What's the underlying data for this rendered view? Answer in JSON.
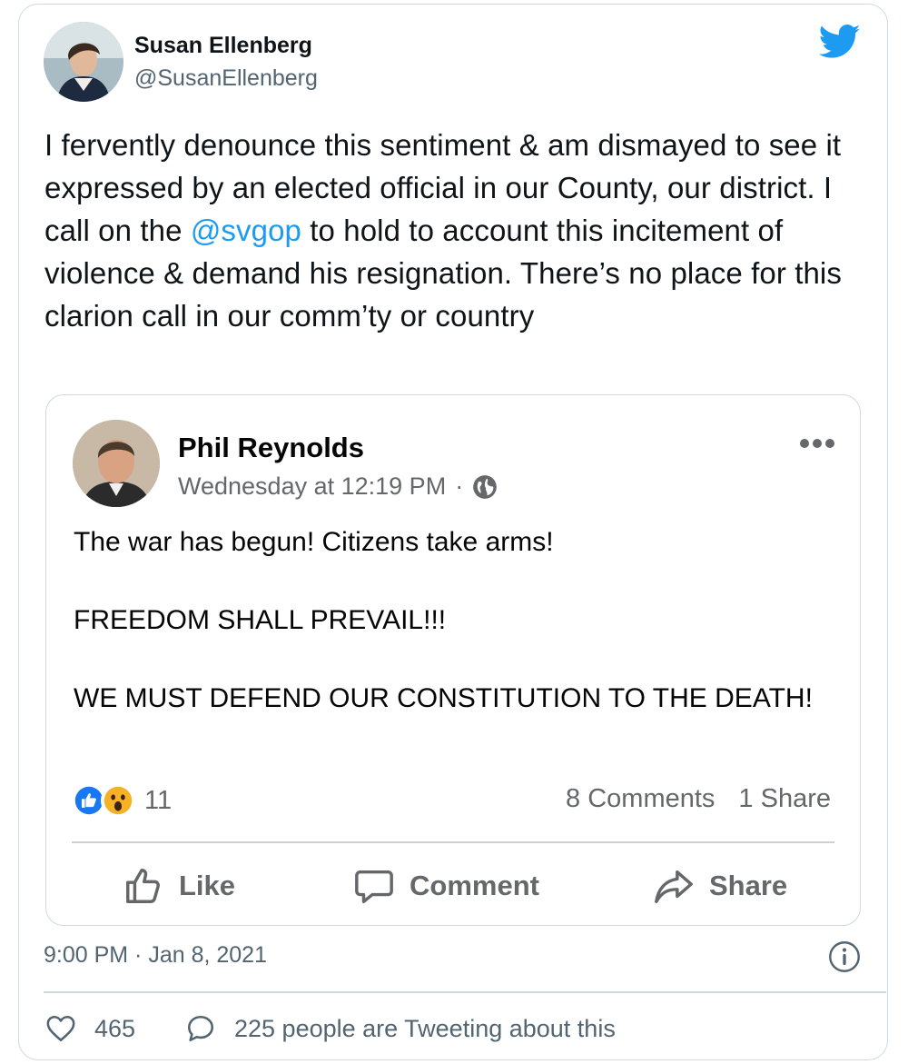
{
  "author": {
    "display_name": "Susan Ellenberg",
    "handle": "@SusanEllenberg"
  },
  "tweet": {
    "text_before_mention": "I fervently denounce this sentiment & am dismayed to see it expressed by an elected official in our County, our district. I call on the ",
    "mention": "@svgop",
    "text_after_mention": " to hold to account this incitement of violence & demand his resignation. There’s no place for this clarion call in our comm’ty or country",
    "timestamp": "9:00 PM · Jan 8, 2021",
    "likes": "465",
    "tweeting_about": "225 people are Tweeting about this"
  },
  "embedded_post": {
    "author": "Phil Reynolds",
    "posted_time": "Wednesday at 12:19 PM",
    "separator": "·",
    "line1": "The war has begun! Citizens take arms!",
    "line2": "FREEDOM SHALL PREVAIL!!!",
    "line3": "WE MUST DEFEND OUR CONSTITUTION TO THE DEATH!",
    "reaction_count": "11",
    "comments": "8 Comments",
    "shares": "1 Share",
    "actions": {
      "like": "Like",
      "comment": "Comment",
      "share": "Share"
    }
  },
  "colors": {
    "twitter_blue": "#1d9bf0",
    "fb_like_blue": "#1877f2",
    "text_secondary": "#536471",
    "fb_secondary": "#65676b",
    "border": "#cfd9de"
  },
  "icons": [
    "twitter-bird-icon",
    "globe-icon",
    "more-options-icon",
    "like-reaction-icon",
    "wow-reaction-icon",
    "thumbs-up-icon",
    "comment-bubble-icon",
    "share-arrow-icon",
    "info-icon",
    "heart-icon",
    "reply-bubble-icon"
  ]
}
